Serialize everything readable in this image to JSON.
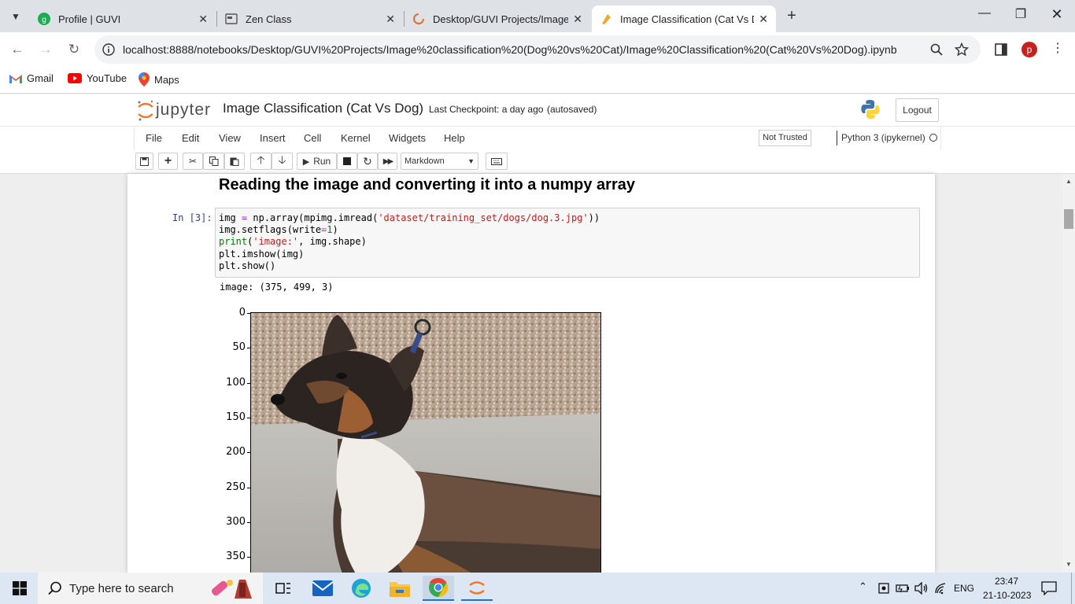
{
  "browser": {
    "tabs": [
      {
        "title": "Profile | GUVI",
        "icon": "guvi-icon"
      },
      {
        "title": "Zen Class",
        "icon": "zen-class-icon"
      },
      {
        "title": "Desktop/GUVI Projects/Image",
        "icon": "jupyter-spinner-icon"
      },
      {
        "title": "Image Classification (Cat Vs D",
        "icon": "jupyter-notebook-icon",
        "active": true
      }
    ],
    "url": "localhost:8888/notebooks/Desktop/GUVI%20Projects/Image%20classification%20(Dog%20vs%20Cat)/Image%20Classification%20(Cat%20Vs%20Dog).ipynb",
    "profile_initial": "p",
    "bookmarks": [
      {
        "label": "Gmail",
        "icon": "gmail-icon"
      },
      {
        "label": "YouTube",
        "icon": "youtube-icon"
      },
      {
        "label": "Maps",
        "icon": "maps-icon"
      }
    ]
  },
  "jupyter": {
    "logo_text": "jupyter",
    "notebook_title": "Image Classification (Cat Vs Dog)",
    "checkpoint": "Last Checkpoint: a day ago",
    "autosaved": "(autosaved)",
    "logout": "Logout",
    "menus": [
      "File",
      "Edit",
      "View",
      "Insert",
      "Cell",
      "Kernel",
      "Widgets",
      "Help"
    ],
    "not_trusted": "Not Trusted",
    "kernel": "Python 3 (ipykernel)",
    "run_label": "Run",
    "cell_type": "Markdown"
  },
  "notebook": {
    "heading": "Reading the image and converting it into a numpy array",
    "prompt": "In [3]:",
    "code": [
      [
        {
          "t": "img ",
          "c": "#000"
        },
        {
          "t": "=",
          "c": "#aa22ff"
        },
        {
          "t": " np.array(mpimg.imread(",
          "c": "#000"
        },
        {
          "t": "'dataset/training_set/dogs/dog.3.jpg'",
          "c": "#ba2121"
        },
        {
          "t": "))",
          "c": "#000"
        }
      ],
      [
        {
          "t": "img.setflags(write",
          "c": "#000"
        },
        {
          "t": "=",
          "c": "#aa22ff"
        },
        {
          "t": "1",
          "c": "#008800"
        },
        {
          "t": ")",
          "c": "#000"
        }
      ],
      [
        {
          "t": "print",
          "c": "#008000"
        },
        {
          "t": "(",
          "c": "#000"
        },
        {
          "t": "'image:'",
          "c": "#ba2121"
        },
        {
          "t": ", img.shape)",
          "c": "#000"
        }
      ],
      [
        {
          "t": "plt.imshow(img)",
          "c": "#000"
        }
      ],
      [
        {
          "t": "plt.show()",
          "c": "#000"
        }
      ]
    ],
    "output_text": "image: (375, 499, 3)",
    "yticks": [
      "0",
      "50",
      "100",
      "150",
      "200",
      "250",
      "300",
      "350"
    ]
  },
  "taskbar": {
    "search_placeholder": "Type here to search",
    "lang": "ENG",
    "time": "23:47",
    "date": "21-10-2023"
  }
}
